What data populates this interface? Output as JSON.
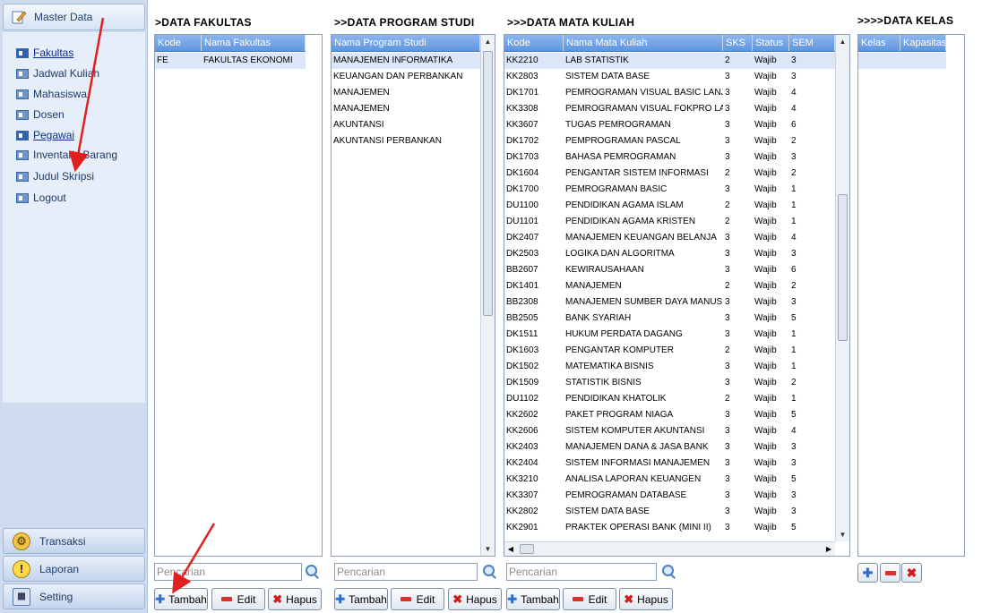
{
  "sidebar": {
    "header_label": "Master Data",
    "items": [
      {
        "label": "Fakultas",
        "link": true
      },
      {
        "label": "Jadwal Kuliah",
        "link": false
      },
      {
        "label": "Mahasiswa",
        "link": false
      },
      {
        "label": "Dosen",
        "link": false
      },
      {
        "label": "Pegawai",
        "link": true
      },
      {
        "label": "Inventaris Barang",
        "link": false
      },
      {
        "label": "Judul Skripsi",
        "link": false
      },
      {
        "label": "Logout",
        "link": false
      }
    ],
    "bottom": [
      {
        "label": "Transaksi",
        "icon": "gear-icon"
      },
      {
        "label": "Laporan",
        "icon": "warning-icon"
      },
      {
        "label": "Setting",
        "icon": "computer-icon"
      }
    ]
  },
  "fakultas": {
    "heading": ">DATA FAKULTAS",
    "columns": [
      "Kode",
      "Nama Fakultas"
    ],
    "rows": [
      [
        "FE",
        "FAKULTAS EKONOMI"
      ]
    ],
    "search_placeholder": "Pencarian"
  },
  "prodi": {
    "heading": ">>DATA PROGRAM STUDI",
    "columns": [
      "Nama Program Studi"
    ],
    "rows": [
      [
        "MANAJEMEN INFORMATIKA"
      ],
      [
        "KEUANGAN DAN PERBANKAN"
      ],
      [
        "MANAJEMEN"
      ],
      [
        "MANAJEMEN"
      ],
      [
        "AKUNTANSI"
      ],
      [
        "AKUNTANSI PERBANKAN"
      ]
    ],
    "search_placeholder": "Pencarian"
  },
  "matkul": {
    "heading": ">>>DATA MATA KULIAH",
    "columns": [
      "Kode",
      "Nama Mata Kuliah",
      "SKS",
      "Status",
      "SEM"
    ],
    "rows": [
      [
        "KK2210",
        "LAB STATISTIK",
        "2",
        "Wajib",
        "3"
      ],
      [
        "KK2803",
        "SISTEM DATA BASE",
        "3",
        "Wajib",
        "3"
      ],
      [
        "DK1701",
        "PEMROGRAMAN VISUAL BASIC LANJUTAN",
        "3",
        "Wajib",
        "4"
      ],
      [
        "KK3308",
        "PEMROGRAMAN VISUAL FOKPRO LANJUTAN",
        "3",
        "Wajib",
        "4"
      ],
      [
        "KK3607",
        "TUGAS PEMROGRAMAN",
        "3",
        "Wajib",
        "6"
      ],
      [
        "DK1702",
        "PEMPROGRAMAN PASCAL",
        "3",
        "Wajib",
        "2"
      ],
      [
        "DK1703",
        "BAHASA PEMROGRAMAN",
        "3",
        "Wajib",
        "3"
      ],
      [
        "DK1604",
        "PENGANTAR SISTEM INFORMASI",
        "2",
        "Wajib",
        "2"
      ],
      [
        "DK1700",
        "PEMROGRAMAN BASIC",
        "3",
        "Wajib",
        "1"
      ],
      [
        "DU1100",
        "PENDIDIKAN AGAMA ISLAM",
        "2",
        "Wajib",
        "1"
      ],
      [
        "DU1101",
        "PENDIDIKAN AGAMA KRISTEN",
        "2",
        "Wajib",
        "1"
      ],
      [
        "DK2407",
        "MANAJEMEN KEUANGAN  BELANJA",
        "3",
        "Wajib",
        "4"
      ],
      [
        "DK2503",
        "LOGIKA DAN ALGORITMA",
        "3",
        "Wajib",
        "3"
      ],
      [
        "BB2607",
        "KEWIRAUSAHAAN",
        "3",
        "Wajib",
        "6"
      ],
      [
        "DK1401",
        "MANAJEMEN",
        "2",
        "Wajib",
        "2"
      ],
      [
        "BB2308",
        "MANAJEMEN SUMBER DAYA MANUSIA",
        "3",
        "Wajib",
        "3"
      ],
      [
        "BB2505",
        "BANK SYARIAH",
        "3",
        "Wajib",
        "5"
      ],
      [
        "DK1511",
        "HUKUM PERDATA  DAGANG",
        "3",
        "Wajib",
        "1"
      ],
      [
        "DK1603",
        "PENGANTAR KOMPUTER",
        "2",
        "Wajib",
        "1"
      ],
      [
        "DK1502",
        "MATEMATIKA BISNIS",
        "3",
        "Wajib",
        "1"
      ],
      [
        "DK1509",
        "STATISTIK BISNIS",
        "3",
        "Wajib",
        "2"
      ],
      [
        "DU1102",
        "PENDIDIKAN KHATOLIK",
        "2",
        "Wajib",
        "1"
      ],
      [
        "KK2602",
        "PAKET PROGRAM NIAGA",
        "3",
        "Wajib",
        "5"
      ],
      [
        "KK2606",
        "SISTEM KOMPUTER AKUNTANSI",
        "3",
        "Wajib",
        "4"
      ],
      [
        "KK2403",
        "MANAJEMEN DANA & JASA BANK",
        "3",
        "Wajib",
        "3"
      ],
      [
        "KK2404",
        "SISTEM INFORMASI MANAJEMEN",
        "3",
        "Wajib",
        "3"
      ],
      [
        "KK3210",
        "ANALISA LAPORAN KEUANGEN",
        "3",
        "Wajib",
        "5"
      ],
      [
        "KK3307",
        "PEMROGRAMAN DATABASE",
        "3",
        "Wajib",
        "3"
      ],
      [
        "KK2802",
        "SISTEM DATA BASE",
        "3",
        "Wajib",
        "3"
      ],
      [
        "KK2901",
        "PRAKTEK OPERASI BANK (MINI II)",
        "3",
        "Wajib",
        "5"
      ]
    ],
    "search_placeholder": "Pencarian"
  },
  "kelas": {
    "heading": ">>>>DATA KELAS",
    "columns": [
      "Kelas",
      "Kapasitas"
    ],
    "rows": []
  },
  "buttons": {
    "tambah": "Tambah",
    "edit": "Edit",
    "hapus": "Hapus"
  },
  "colors": {
    "header_blue": "#5e95e0",
    "sidebar_bg": "#cfdcf0",
    "annotation_arrow": "#e02020"
  }
}
